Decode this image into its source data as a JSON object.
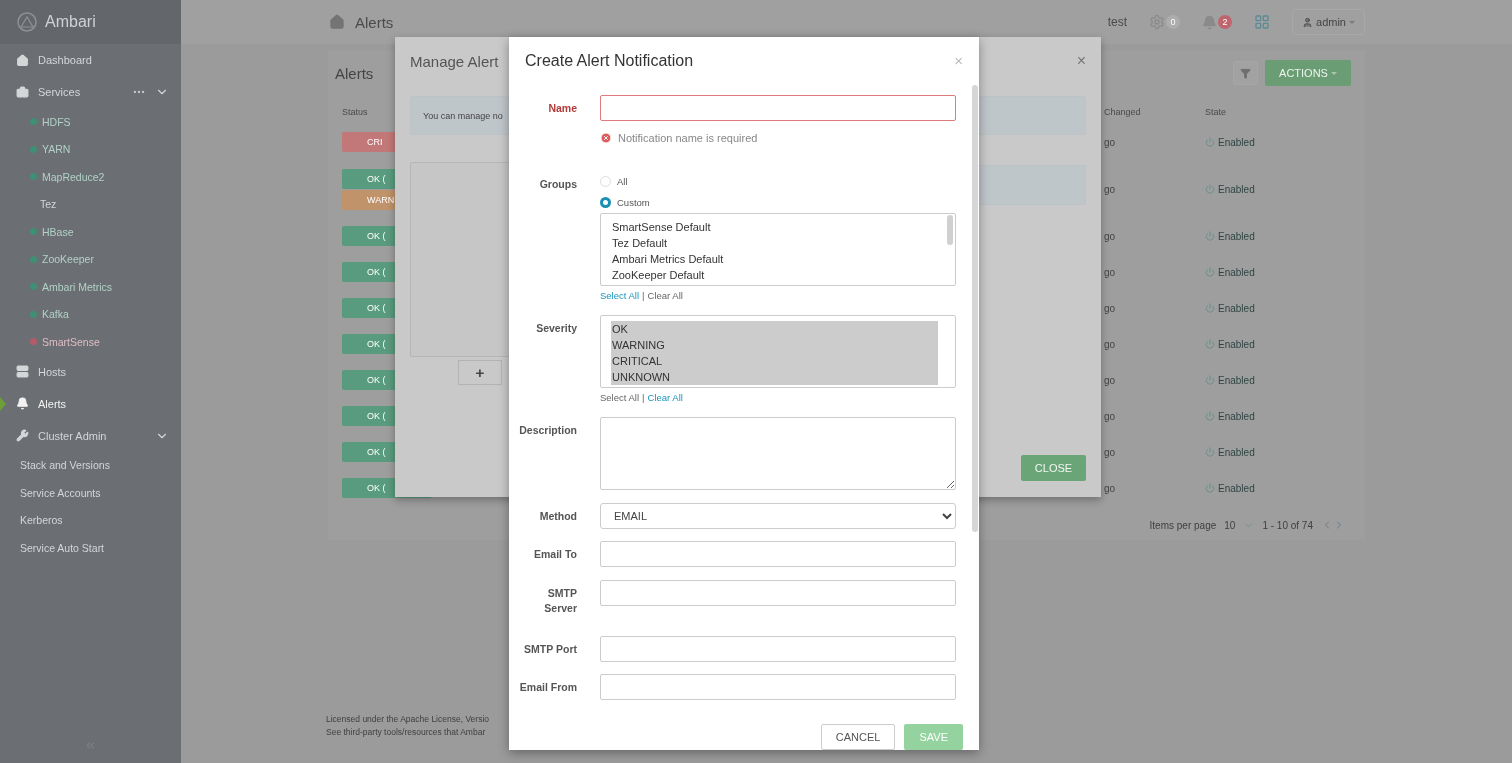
{
  "sidebar": {
    "brand": "Ambari",
    "nav": [
      {
        "label": "Dashboard",
        "selected": false
      },
      {
        "label": "Services",
        "selected": false,
        "expanded": true,
        "children": [
          {
            "label": "HDFS",
            "color": "#3f8f74"
          },
          {
            "label": "YARN",
            "color": "#3f8f74"
          },
          {
            "label": "MapReduce2",
            "color": "#3f8f74"
          },
          {
            "label": "Tez"
          },
          {
            "label": "HBase",
            "color": "#3f8f74"
          },
          {
            "label": "ZooKeeper",
            "color": "#3f8f74"
          },
          {
            "label": "Ambari Metrics",
            "color": "#3f8f74"
          },
          {
            "label": "Kafka",
            "color": "#3f8f74"
          },
          {
            "label": "SmartSense",
            "color": "#b25c69"
          }
        ]
      },
      {
        "label": "Hosts",
        "selected": false
      },
      {
        "label": "Alerts",
        "selected": true
      },
      {
        "label": "Cluster Admin",
        "selected": false,
        "expanded": true,
        "children": [
          {
            "label": "Stack and Versions"
          },
          {
            "label": "Service Accounts"
          },
          {
            "label": "Kerberos"
          },
          {
            "label": "Service Auto Start"
          }
        ]
      }
    ]
  },
  "topbar": {
    "breadcrumb": "Alerts",
    "cluster": "test",
    "ops_badge": "0",
    "alerts_badge": "2",
    "user": "admin"
  },
  "alerts": {
    "title": "Alerts",
    "actions_button": "ACTIONS",
    "columns": [
      {
        "label": "Status"
      },
      {
        "label": "Changed"
      },
      {
        "label": "State"
      }
    ],
    "rows": [
      {
        "status": [
          {
            "label": "CRI",
            "kind": "critical"
          }
        ],
        "changed": "go",
        "state": "Enabled"
      },
      {
        "status": [
          {
            "label": "OK (",
            "kind": "ok"
          },
          {
            "label": "WARN",
            "kind": "warning"
          }
        ],
        "changed": "go",
        "state": "Enabled"
      },
      {
        "status": [
          {
            "label": "OK (",
            "kind": "ok"
          }
        ],
        "changed": "go",
        "state": "Enabled"
      },
      {
        "status": [
          {
            "label": "OK (",
            "kind": "ok"
          }
        ],
        "changed": "go",
        "state": "Enabled"
      },
      {
        "status": [
          {
            "label": "OK (",
            "kind": "ok"
          }
        ],
        "changed": "go",
        "state": "Enabled"
      },
      {
        "status": [
          {
            "label": "OK (",
            "kind": "ok"
          }
        ],
        "changed": "go",
        "state": "Enabled"
      },
      {
        "status": [
          {
            "label": "OK (",
            "kind": "ok"
          }
        ],
        "changed": "go",
        "state": "Enabled"
      },
      {
        "status": [
          {
            "label": "OK (",
            "kind": "ok"
          }
        ],
        "changed": "go",
        "state": "Enabled"
      },
      {
        "status": [
          {
            "label": "OK (",
            "kind": "ok"
          }
        ],
        "changed": "go",
        "state": "Enabled"
      },
      {
        "status": [
          {
            "label": "OK (",
            "kind": "ok"
          }
        ],
        "changed": "go",
        "state": "Enabled"
      }
    ],
    "pagination": {
      "label": "Items per page",
      "per_page": "10",
      "range": "1 - 10 of 74"
    }
  },
  "footer": [
    "Licensed under the Apache License, Versio",
    "See third-party tools/resources that Ambar"
  ],
  "manage_dialog": {
    "title": "Manage Alert",
    "close": "×",
    "info": "You can manage no",
    "add_button": "+",
    "close_button": "CLOSE"
  },
  "create_dialog": {
    "title": "Create Alert Notification",
    "close": "×",
    "fields": [
      {
        "kind": "text",
        "label": "Name",
        "invalid": true,
        "error": "Notification name is required"
      },
      {
        "kind": "groups",
        "label": "Groups",
        "options": [
          {
            "label": "All",
            "selected": false
          },
          {
            "label": "Custom",
            "selected": true
          }
        ],
        "items": [
          {
            "label": "SmartSense Default",
            "selected": false
          },
          {
            "label": "Tez Default",
            "selected": false
          },
          {
            "label": "Ambari Metrics Default",
            "selected": false
          },
          {
            "label": "ZooKeeper Default",
            "selected": false
          }
        ],
        "links": [
          {
            "label": "Select All",
            "disabled": false
          },
          {
            "label": "Clear All",
            "disabled": true
          }
        ],
        "separator": "|"
      },
      {
        "kind": "list",
        "label": "Severity",
        "items": [
          {
            "label": "OK",
            "selected": true
          },
          {
            "label": "WARNING",
            "selected": true
          },
          {
            "label": "CRITICAL",
            "selected": true
          },
          {
            "label": "UNKNOWN",
            "selected": true
          }
        ],
        "links": [
          {
            "label": "Select All",
            "disabled": true
          },
          {
            "label": "Clear All",
            "disabled": false
          }
        ],
        "separator": "|"
      },
      {
        "kind": "textarea",
        "label": "Description"
      },
      {
        "kind": "select",
        "label": "Method",
        "value": "EMAIL"
      },
      {
        "kind": "text",
        "label": "Email To",
        "invalid": false
      },
      {
        "kind": "text",
        "label": "SMTP Server",
        "invalid": false
      },
      {
        "kind": "text",
        "label": "SMTP Port",
        "invalid": false
      },
      {
        "kind": "text",
        "label": "Email From",
        "invalid": false
      }
    ],
    "buttons": [
      {
        "label": "CANCEL",
        "kind": "default",
        "disabled": false
      },
      {
        "label": "SAVE",
        "kind": "primary",
        "disabled": true
      }
    ]
  }
}
